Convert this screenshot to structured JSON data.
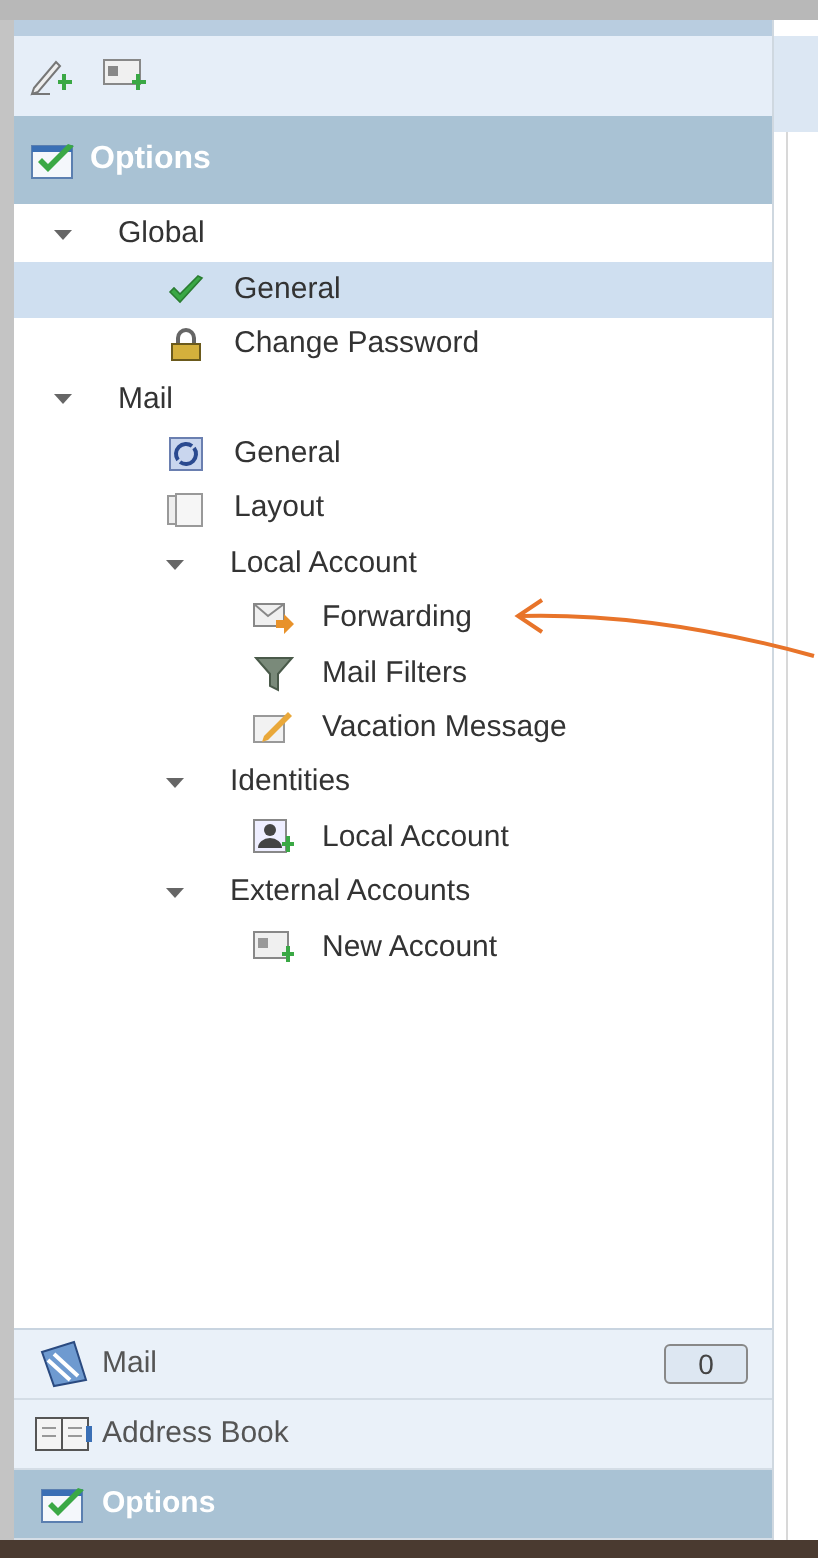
{
  "header": {
    "title": "Options"
  },
  "tree": [
    {
      "label": "Global",
      "expanded": true,
      "selected": false,
      "children": [
        {
          "label": "General",
          "selected": true
        },
        {
          "label": "Change Password",
          "selected": false
        }
      ]
    },
    {
      "label": "Mail",
      "expanded": true,
      "selected": false,
      "children": [
        {
          "label": "General",
          "selected": false
        },
        {
          "label": "Layout",
          "selected": false
        },
        {
          "label": "Local Account",
          "expanded": true,
          "selected": false,
          "children": [
            {
              "label": "Forwarding",
              "selected": false
            },
            {
              "label": "Mail Filters",
              "selected": false
            },
            {
              "label": "Vacation Message",
              "selected": false
            }
          ]
        },
        {
          "label": "Identities",
          "expanded": true,
          "selected": false,
          "children": [
            {
              "label": "Local Account",
              "selected": false
            }
          ]
        },
        {
          "label": "External Accounts",
          "expanded": true,
          "selected": false,
          "children": [
            {
              "label": "New Account",
              "selected": false
            }
          ]
        }
      ]
    }
  ],
  "nav": [
    {
      "label": "Mail",
      "selected": false,
      "count": "0"
    },
    {
      "label": "Address Book",
      "selected": false
    },
    {
      "label": "Options",
      "selected": true
    }
  ]
}
